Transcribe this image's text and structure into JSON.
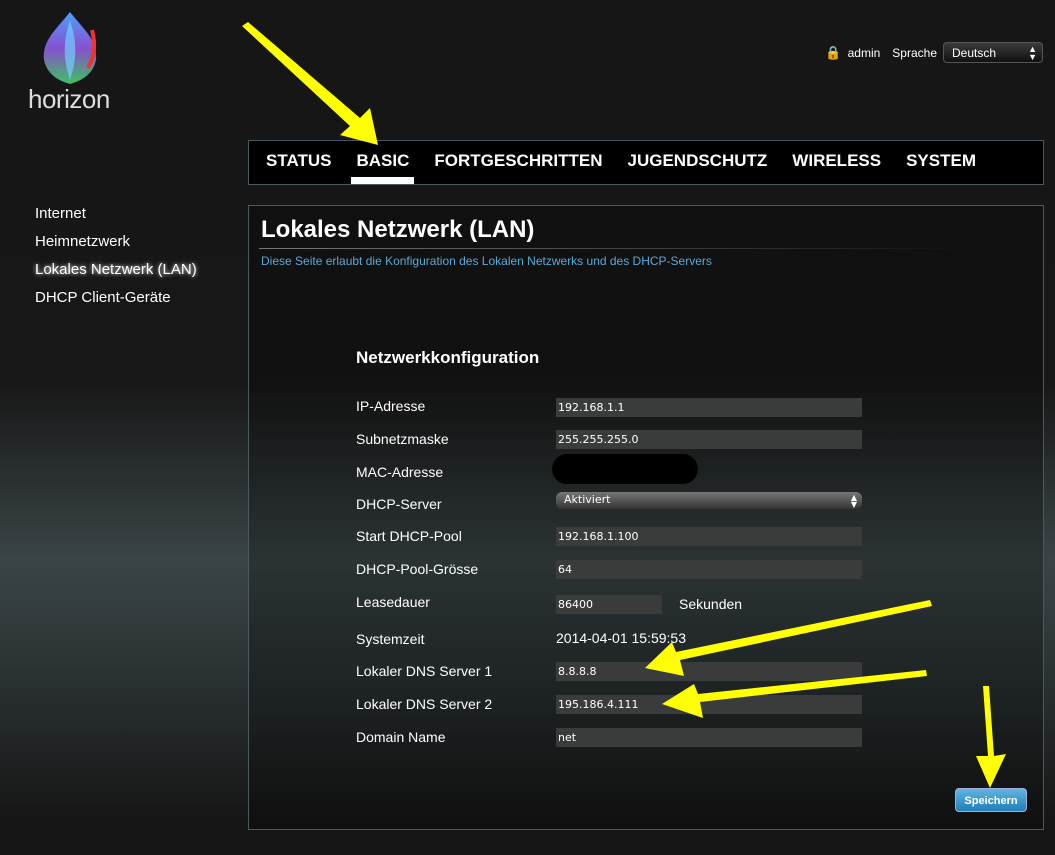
{
  "brand": {
    "logo_text": "horizon"
  },
  "header": {
    "user": "admin",
    "language_label": "Sprache",
    "language_value": "Deutsch"
  },
  "nav": {
    "tabs": [
      {
        "label": "STATUS"
      },
      {
        "label": "BASIC",
        "active": true
      },
      {
        "label": "FORTGESCHRITTEN"
      },
      {
        "label": "JUGENDSCHUTZ"
      },
      {
        "label": "WIRELESS"
      },
      {
        "label": "SYSTEM"
      }
    ]
  },
  "sidebar": {
    "items": [
      {
        "label": "Internet"
      },
      {
        "label": "Heimnetzwerk"
      },
      {
        "label": "Lokales Netzwerk (LAN)",
        "active": true
      },
      {
        "label": "DHCP Client-Geräte"
      }
    ]
  },
  "page": {
    "title": "Lokales Netzwerk (LAN)",
    "description": "Diese Seite erlaubt die Konfiguration des Lokalen Netzwerks und des DHCP-Servers",
    "section": "Netzwerkkonfiguration"
  },
  "form": {
    "ip": {
      "label": "IP-Adresse",
      "value": "192.168.1.1"
    },
    "subnet": {
      "label": "Subnetzmaske",
      "value": "255.255.255.0"
    },
    "mac": {
      "label": "MAC-Adresse"
    },
    "dhcp": {
      "label": "DHCP-Server",
      "value": "Aktiviert"
    },
    "pool_start": {
      "label": "Start DHCP-Pool",
      "value": "192.168.1.100"
    },
    "pool_size": {
      "label": "DHCP-Pool-Grösse",
      "value": "64"
    },
    "lease": {
      "label": "Leasedauer",
      "value": "86400",
      "unit": "Sekunden"
    },
    "time": {
      "label": "Systemzeit",
      "value": "2014-04-01 15:59:53"
    },
    "dns1": {
      "label": "Lokaler DNS Server 1",
      "value": "8.8.8.8"
    },
    "dns2": {
      "label": "Lokaler DNS Server 2",
      "value": "195.186.4.111"
    },
    "domain": {
      "label": "Domain Name",
      "value": "net"
    },
    "save_label": "Speichern"
  },
  "colors": {
    "accent": "#5aa9d8",
    "annotation": "#ffff00"
  }
}
